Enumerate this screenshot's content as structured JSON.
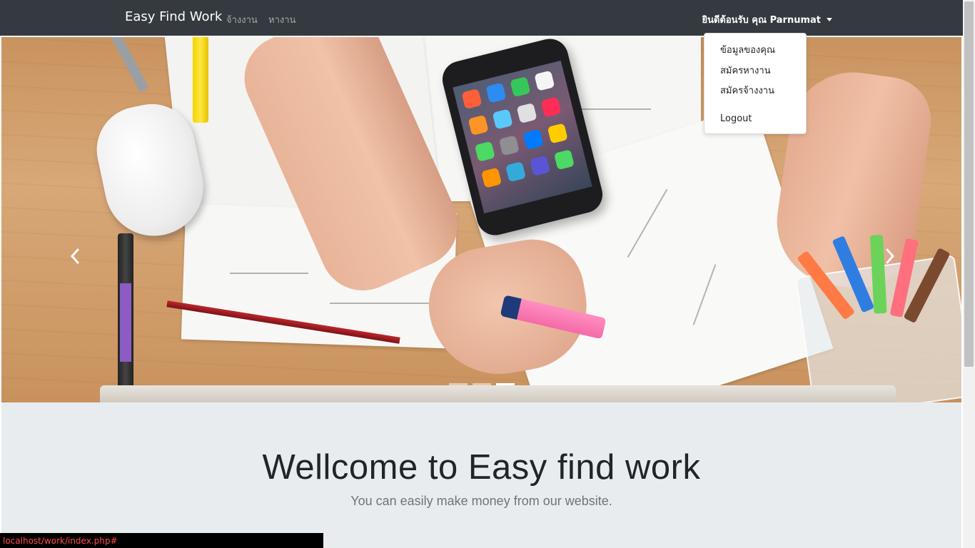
{
  "navbar": {
    "brand": "Easy Find Work",
    "links": [
      {
        "label": "จ้างงาน"
      },
      {
        "label": "หางาน"
      }
    ],
    "user_greeting": "ยินดีต้อนรับ คุณ Parnumat"
  },
  "user_menu": {
    "items": [
      {
        "label": "ข้อมูลของคุณ"
      },
      {
        "label": "สมัครหางาน"
      },
      {
        "label": "สมัครจ้างงาน"
      },
      {
        "label": "Logout"
      }
    ]
  },
  "carousel": {
    "slide_count": 3,
    "active_index": 2,
    "prev_icon": "chevron-left-icon",
    "next_icon": "chevron-right-icon"
  },
  "hero": {
    "title": "Wellcome to Easy find work",
    "subtitle": "You can easily make money from our website."
  },
  "status_bar": {
    "url": "localhost/work/index.php#"
  },
  "colors": {
    "navbar_bg": "#343a40",
    "jumbotron_bg": "#e9ecef",
    "status_text": "#ff4d4d"
  }
}
